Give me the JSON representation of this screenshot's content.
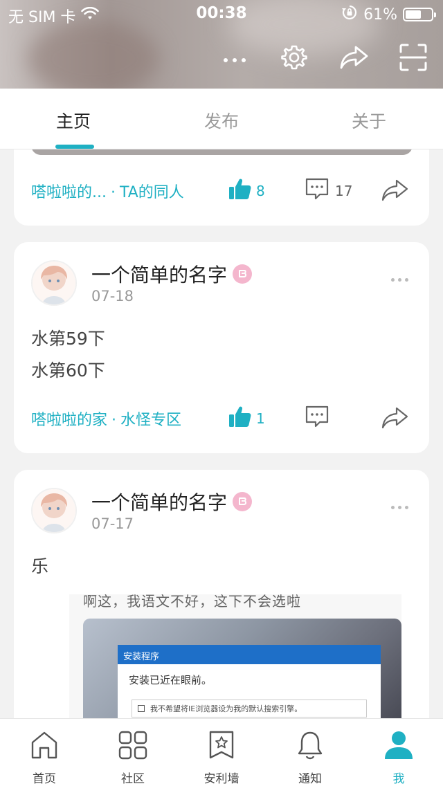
{
  "status_bar": {
    "carrier": "无 SIM 卡",
    "time": "00:38",
    "battery_percent": "61%",
    "battery_level": 0.61
  },
  "header": {
    "more_label": "···"
  },
  "tabs": [
    {
      "label": "主页",
      "active": true
    },
    {
      "label": "发布",
      "active": false
    },
    {
      "label": "关于",
      "active": false
    }
  ],
  "top_card": {
    "tags": [
      "嗒啦啦的...",
      "TA的同人"
    ],
    "likes": "8",
    "comments": "17"
  },
  "posts": [
    {
      "author": "一个简单的名字",
      "date": "07-18",
      "lines": [
        "水第59下",
        "水第60下"
      ],
      "tags": [
        "嗒啦啦的家",
        "水怪专区"
      ],
      "likes": "1",
      "comments": ""
    },
    {
      "author": "一个简单的名字",
      "date": "07-17",
      "lines": [
        "乐"
      ],
      "image": {
        "caption": "啊这，我语文不好，这下不会选啦",
        "dialog_title": "安装程序",
        "dialog_text": "安装已近在眼前。",
        "dialog_check": "我不希望将IE浏览器设为我的默认搜索引擎。"
      }
    }
  ],
  "bottom_nav": [
    {
      "label": "首页",
      "icon": "home-icon",
      "active": false
    },
    {
      "label": "社区",
      "icon": "grid-icon",
      "active": false
    },
    {
      "label": "安利墙",
      "icon": "bookmark-star-icon",
      "active": false
    },
    {
      "label": "通知",
      "icon": "bell-icon",
      "active": false
    },
    {
      "label": "我",
      "icon": "person-icon",
      "active": true
    }
  ],
  "colors": {
    "accent": "#1fb0c3",
    "badge_pink": "#f4b6cd"
  }
}
